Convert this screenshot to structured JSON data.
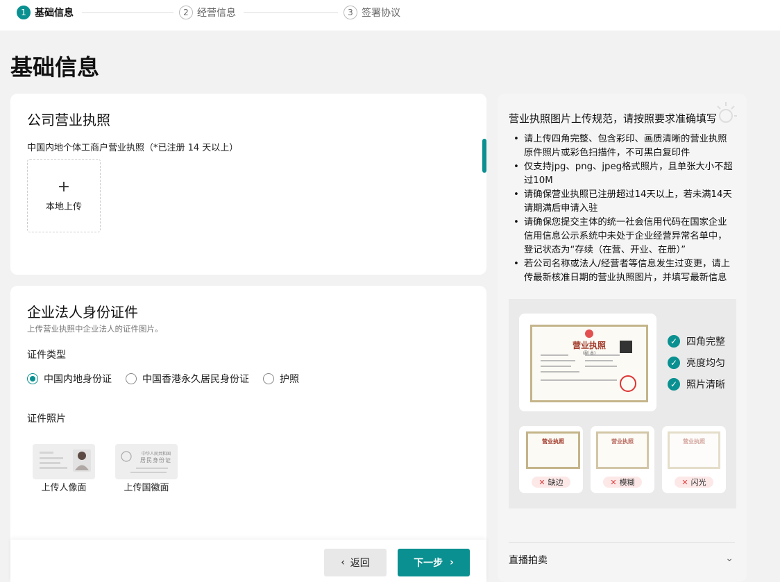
{
  "steps": [
    {
      "num": "1",
      "label": "基础信息"
    },
    {
      "num": "2",
      "label": "经营信息"
    },
    {
      "num": "3",
      "label": "签署协议"
    }
  ],
  "page_title": "基础信息",
  "license": {
    "title": "公司营业执照",
    "desc": "中国内地个体工商户营业执照（*已注册 14 天以上）",
    "upload_plus": "+",
    "upload_label": "本地上传"
  },
  "legal": {
    "title": "企业法人身份证件",
    "desc": "上传营业执照中企业法人的证件图片。",
    "type_label": "证件类型",
    "options": [
      "中国内地身份证",
      "中国香港永久居民身份证",
      "护照"
    ],
    "selected": "中国内地身份证",
    "photo_label": "证件照片",
    "front_label": "上传人像面",
    "back_label": "上传国徽面",
    "back_card_text1": "中华人民共和国",
    "back_card_text2": "居民身份证"
  },
  "footer": {
    "back": "返回",
    "next": "下一步",
    "back_icon": "chevron-left-icon",
    "next_icon": "chevron-right-icon"
  },
  "side": {
    "title": "营业执照图片上传规范，请按照要求准确填写",
    "rules": [
      "请上传四角完整、包含彩印、画质清晰的营业执照原件照片或彩色扫描件，不可黑白复印件",
      "仅支持jpg、png、jpeg格式照片，且单张大小不超过10M",
      "请确保营业执照已注册超过14天以上，若未满14天请期满后申请入驻",
      "请确保您提交主体的统一社会信用代码在国家企业信用信息公示系统中未处于企业经营异常名单中，登记状态为“存续（在营、开业、在册）”",
      "若公司名称或法人/经营者等信息发生过变更，请上传最新核准日期的营业执照图片，并填写最新信息"
    ],
    "cert_title": "营业执照",
    "cert_sub": "(副 本)",
    "good": [
      "四角完整",
      "亮度均匀",
      "照片清晰"
    ],
    "bad": [
      "缺边",
      "模糊",
      "闪光"
    ],
    "accordion": "直播拍卖"
  },
  "colors": {
    "accent": "#0a9090",
    "error": "#e04040"
  }
}
